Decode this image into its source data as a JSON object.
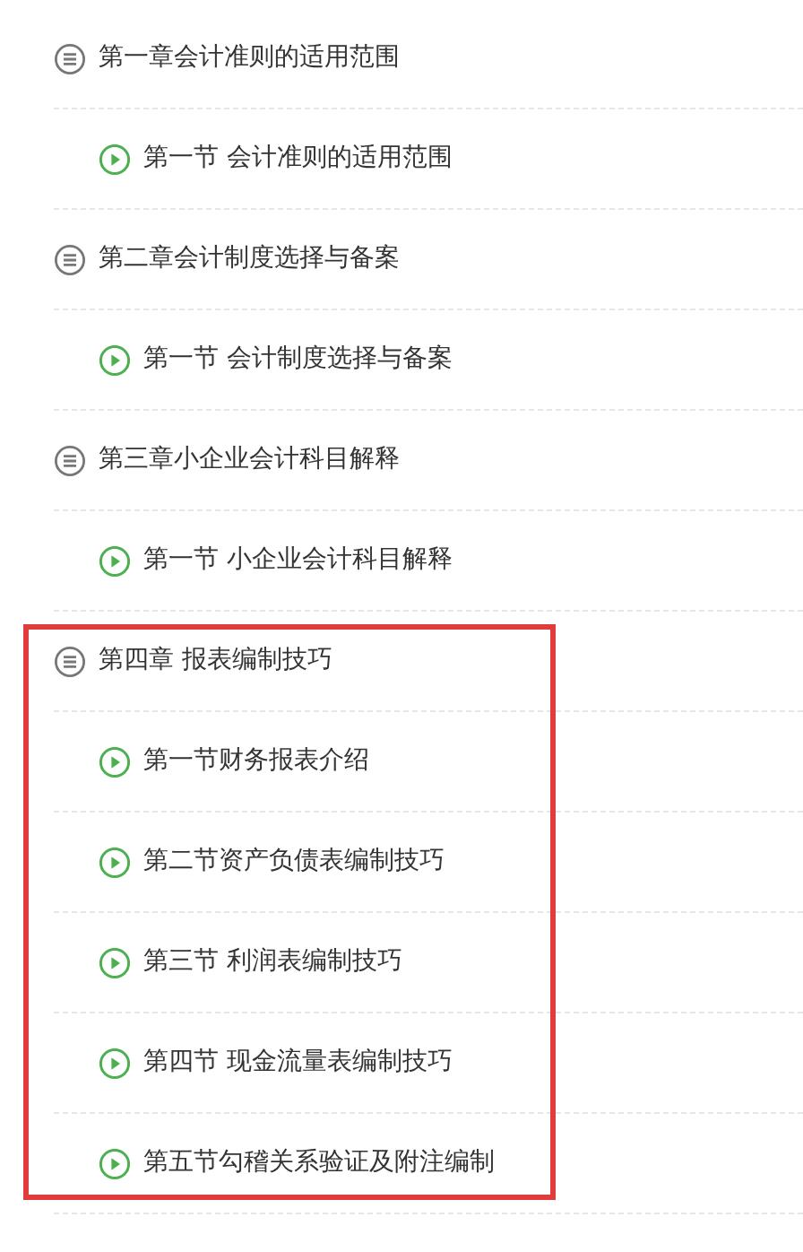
{
  "chapters": [
    {
      "title": "第一章会计准则的适用范围",
      "highlighted": false,
      "sections": [
        {
          "title": "第一节 会计准则的适用范围"
        }
      ]
    },
    {
      "title": "第二章会计制度选择与备案",
      "highlighted": false,
      "sections": [
        {
          "title": "第一节 会计制度选择与备案"
        }
      ]
    },
    {
      "title": "第三章小企业会计科目解释",
      "highlighted": false,
      "sections": [
        {
          "title": "第一节 小企业会计科目解释"
        }
      ]
    },
    {
      "title": "第四章 报表编制技巧",
      "highlighted": true,
      "sections": [
        {
          "title": "第一节财务报表介绍"
        },
        {
          "title": "第二节资产负债表编制技巧"
        },
        {
          "title": "第三节 利润表编制技巧"
        },
        {
          "title": "第四节 现金流量表编制技巧"
        },
        {
          "title": "第五节勾稽关系验证及附注编制"
        }
      ]
    }
  ]
}
